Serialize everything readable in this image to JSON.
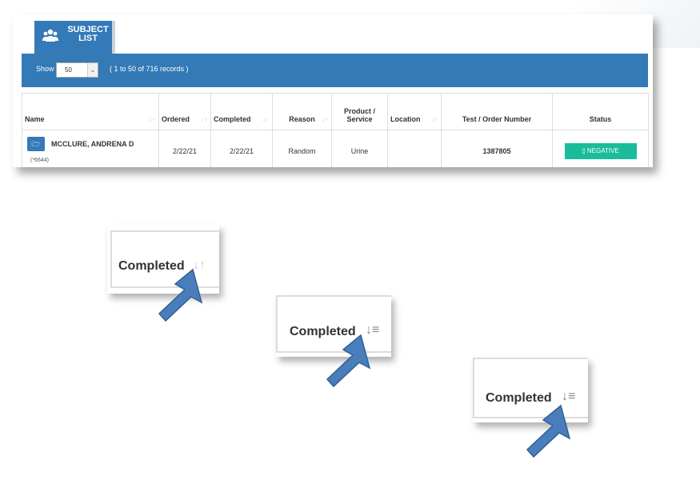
{
  "tab": {
    "line1": "SUBJECT",
    "line2": "LIST"
  },
  "toolbar": {
    "show_label": "Show",
    "page_size": "50",
    "records_text": "( 1 to 50 of 716 records )"
  },
  "table": {
    "headers": {
      "name": "Name",
      "ordered": "Ordered",
      "completed": "Completed",
      "reason": "Reason",
      "product_line1": "Product /",
      "product_line2": "Service",
      "location": "Location",
      "test_order": "Test / Order Number",
      "status": "Status"
    },
    "rows": [
      {
        "name": "MCCLURE, ANDRENA D",
        "id": "(*6644)",
        "ordered": "2/22/21",
        "completed": "2/22/21",
        "reason": "Random",
        "product": "Urine",
        "location": "",
        "order_number": "1387805",
        "status": "NEGATIVE"
      }
    ]
  },
  "callouts": [
    {
      "label": "Completed",
      "sort_state": "unsorted-icon"
    },
    {
      "label": "Completed",
      "sort_state": "sort-ascending-icon"
    },
    {
      "label": "Completed",
      "sort_state": "sort-descending-icon"
    }
  ],
  "colors": {
    "primary": "#337ab7",
    "status_negative": "#1abc9c",
    "arrow": "#4a7ebb"
  }
}
